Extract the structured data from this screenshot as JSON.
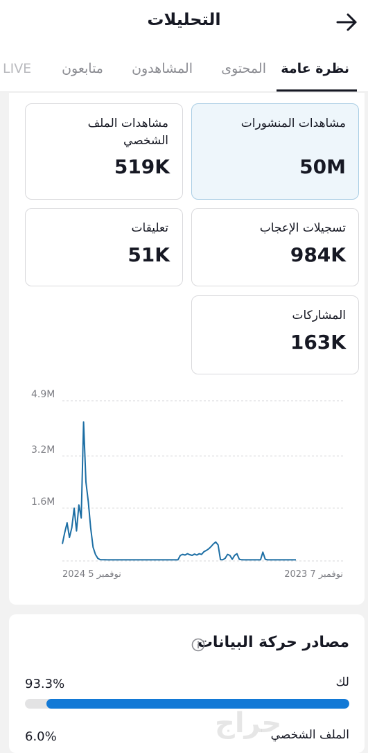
{
  "header": {
    "title": "التحليلات",
    "back_icon": "arrow-right-icon"
  },
  "tabs": [
    {
      "label": "نظرة عامة",
      "active": true
    },
    {
      "label": "المحتوى",
      "active": false
    },
    {
      "label": "المشاهدون",
      "active": false
    },
    {
      "label": "متابعون",
      "active": false
    },
    {
      "label": "LIVE",
      "active": false
    }
  ],
  "metrics": {
    "post_views": {
      "label": "مشاهدات المنشورات",
      "value": "50M"
    },
    "profile_views": {
      "label": "مشاهدات الملف الشخصي",
      "value": "519K"
    },
    "likes": {
      "label": "تسجيلات الإعجاب",
      "value": "984K"
    },
    "comments": {
      "label": "تعليقات",
      "value": "51K"
    },
    "shares": {
      "label": "المشاركات",
      "value": "163K"
    }
  },
  "chart_data": {
    "type": "line",
    "y_tick_labels": [
      "4.9M",
      "3.2M",
      "1.6M"
    ],
    "y_tick_values": [
      4900000,
      3200000,
      1600000
    ],
    "ylim": [
      0,
      4900000
    ],
    "x_tick_labels": [
      "نوفمبر 7 2023",
      "نوفمبر 5 2024"
    ],
    "line_color": "#1c6ea4",
    "grid": true,
    "series": [
      {
        "values": [
          500000,
          850000,
          1150000,
          700000,
          1000000,
          1600000,
          900000,
          1700000,
          1300000,
          4250000,
          2400000,
          1800000,
          1000000,
          400000,
          180000,
          60000,
          20000,
          15000,
          15000,
          12000,
          12000,
          12000,
          12000,
          12000,
          12000,
          12000,
          12000,
          12000,
          12000,
          12000,
          12000,
          12000,
          12000,
          12000,
          12000,
          12000,
          12000,
          12000,
          12000,
          12000,
          12000,
          12000,
          12000,
          12000,
          12000,
          12000,
          12000,
          12000,
          12000,
          12000,
          150000,
          180000,
          160000,
          200000,
          170000,
          150000,
          190000,
          160000,
          200000,
          180000,
          260000,
          300000,
          350000,
          420000,
          500000,
          560000,
          470000,
          20000,
          15000,
          60000,
          180000,
          150000,
          30000,
          150000,
          200000,
          30000,
          15000,
          12000,
          12000,
          12000,
          12000,
          12000,
          12000,
          12000,
          12000,
          250000,
          30000,
          12000,
          12000,
          12000,
          12000,
          12000,
          12000,
          12000,
          12000,
          12000,
          12000,
          12000,
          12000,
          12000
        ]
      }
    ]
  },
  "traffic_sources": {
    "title": "مصادر حركة البيانات",
    "info_icon": "info-icon",
    "items": [
      {
        "name": "لك",
        "percent": "93.3%",
        "fraction": 0.933
      },
      {
        "name": "الملف الشخصي",
        "percent": "6.0%",
        "fraction": 0.06
      }
    ]
  },
  "watermark": "حراج"
}
